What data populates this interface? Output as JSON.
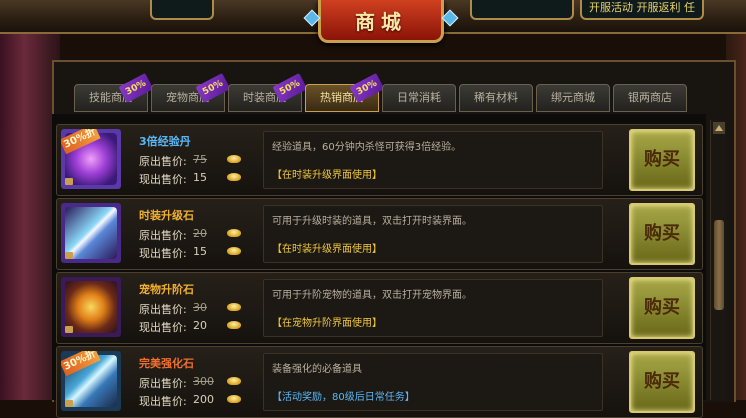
{
  "header": {
    "title": "商城",
    "top_left_text": "",
    "top_right_text": "开服活动   开服返利   任"
  },
  "tabs": [
    {
      "label": "技能商店",
      "badge": "30%"
    },
    {
      "label": "宠物商店",
      "badge": "50%"
    },
    {
      "label": "时装商店",
      "badge": "50%"
    },
    {
      "label": "热销商店",
      "badge": "30%",
      "active": true
    },
    {
      "label": "日常消耗",
      "badge": ""
    },
    {
      "label": "稀有材料",
      "badge": ""
    },
    {
      "label": "绑元商城",
      "badge": ""
    },
    {
      "label": "银两商店",
      "badge": ""
    }
  ],
  "labels": {
    "original_price": "原出售价:",
    "current_price": "现出售价:",
    "buy": "购买"
  },
  "items": [
    {
      "name": "3倍经验丹",
      "name_color": "#5ab8f8",
      "tag": "30%折",
      "old_price": "75",
      "new_price": "15",
      "desc": "经验道具，60分钟内杀怪可获得3倍经验。",
      "link": "【在时装升级界面使用】",
      "link_style": "gold"
    },
    {
      "name": "时装升级石",
      "name_color": "#f0b030",
      "tag": "",
      "old_price": "20",
      "new_price": "15",
      "desc": "可用于升级时装的道具，双击打开时装界面。",
      "link": "【在时装升级界面使用】",
      "link_style": "gold"
    },
    {
      "name": "宠物升阶石",
      "name_color": "#f0b030",
      "tag": "",
      "old_price": "30",
      "new_price": "20",
      "desc": "可用于升阶宠物的道具，双击打开宠物界面。",
      "link": "【在宠物升阶界面使用】",
      "link_style": "gold"
    },
    {
      "name": "完美强化石",
      "name_color": "#f07030",
      "tag": "30%折",
      "old_price": "300",
      "new_price": "200",
      "desc": "装备强化的必备道具",
      "link": "【活动奖励，80级后日常任务】",
      "link_style": "blue"
    }
  ],
  "colors": {
    "accent": "#c8a050",
    "title_bg": "#b02810"
  }
}
